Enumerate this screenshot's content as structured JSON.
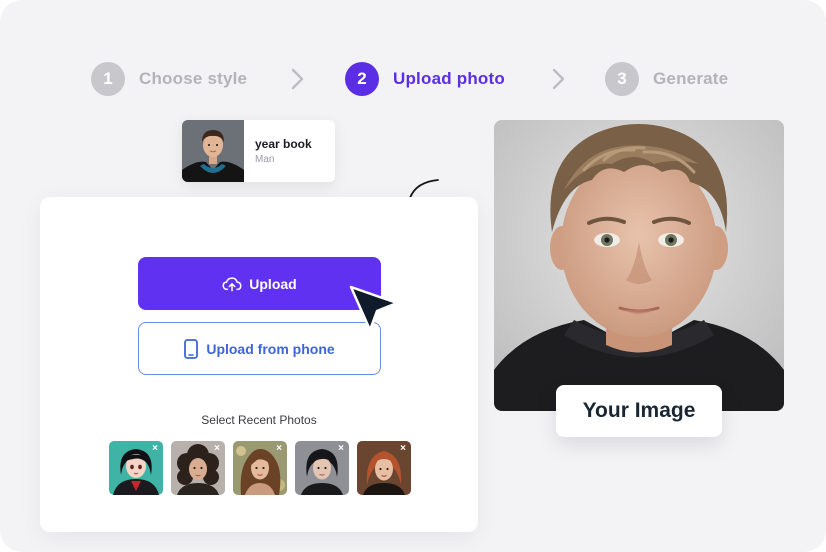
{
  "steps": [
    {
      "number": "1",
      "label": "Choose style",
      "active": false
    },
    {
      "number": "2",
      "label": "Upload photo",
      "active": true
    },
    {
      "number": "3",
      "label": "Generate",
      "active": false
    }
  ],
  "style_card": {
    "title": "year book",
    "subtitle": "Man"
  },
  "upload": {
    "upload_label": "Upload",
    "phone_label": "Upload from phone",
    "recent_label": "Select Recent Photos",
    "recent_photos": [
      {
        "name": "anime-girl-photo"
      },
      {
        "name": "curly-hair-woman-photo"
      },
      {
        "name": "wavy-hair-woman-photo"
      },
      {
        "name": "dark-hair-person-photo"
      },
      {
        "name": "red-hair-woman-photo"
      }
    ],
    "remove_glyph": "×"
  },
  "preview": {
    "caption": "Your Image"
  },
  "colors": {
    "accent": "#5b2ee6",
    "button": "#6131f2",
    "phone_text": "#3f63d9",
    "inactive_step": "#c8c8cc",
    "background": "#f3f3f5"
  },
  "icons": {
    "upload": "cloud-upload-icon",
    "phone": "phone-icon",
    "chevron": "chevron-right-icon",
    "cursor": "pointer-cursor-icon",
    "arrow": "curly-arrow-icon"
  }
}
